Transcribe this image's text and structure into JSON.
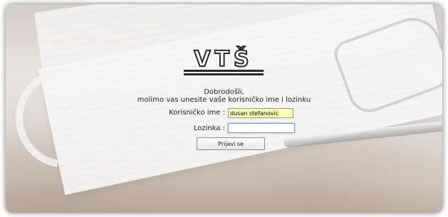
{
  "logo": {
    "text": "VTŠ"
  },
  "greeting": {
    "line1": "Dobrodošli,",
    "line2": "molimo vas unesite vaše korisničko ime i lozinku"
  },
  "form": {
    "username_label": "Korisničko ime :",
    "username_value": "dusan stefanovic",
    "password_label": "Lozinka :",
    "password_value": "",
    "submit_label": "Prijavi se"
  },
  "colors": {
    "username_bg": "#fbfbb4",
    "password_focus": "#7a9cd3"
  }
}
